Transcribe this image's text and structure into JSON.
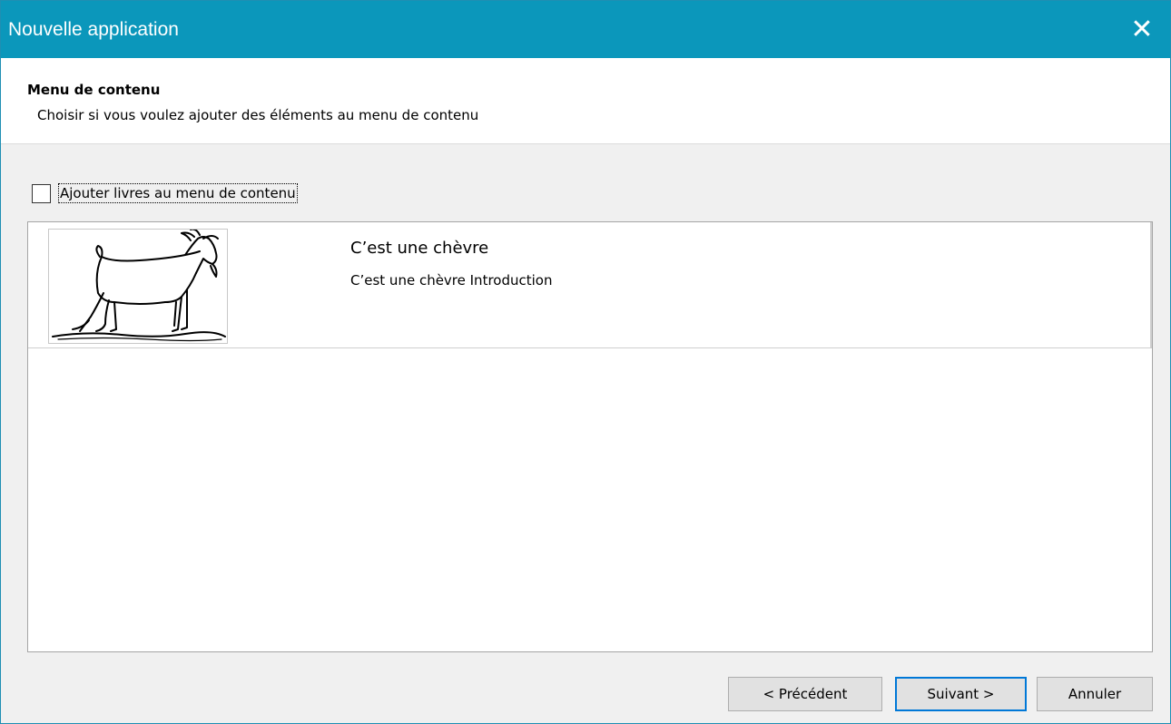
{
  "window": {
    "title": "Nouvelle application",
    "close_icon": "close-icon",
    "accent_color": "#0b97bb"
  },
  "header": {
    "title": "Menu de contenu",
    "subtitle": "Choisir si vous voulez ajouter des éléments au menu de contenu"
  },
  "option": {
    "checkbox_label": "Ajouter livres au menu de contenu",
    "checked": false
  },
  "list": {
    "items": [
      {
        "title": "C’est une chèvre",
        "description": "C’est une chèvre Introduction",
        "thumbnail": "goat-drawing"
      }
    ]
  },
  "buttons": {
    "previous": "< Précédent",
    "next": "Suivant >",
    "cancel": "Annuler"
  }
}
